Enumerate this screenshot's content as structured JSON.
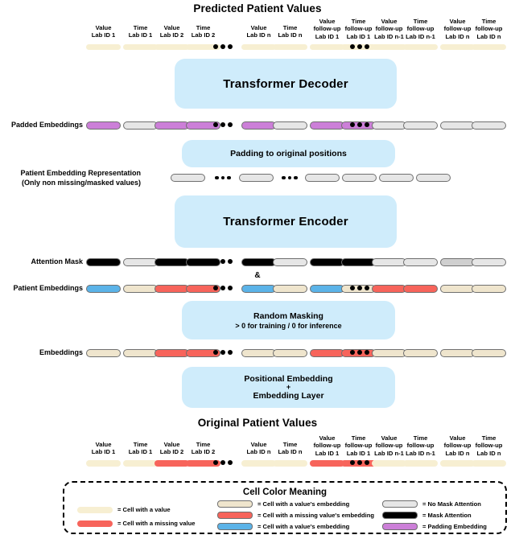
{
  "diagram": {
    "top_title": "Predicted Patient Values",
    "bottom_title": "Original Patient Values",
    "amp": "&"
  },
  "colors": {
    "value_cream": "#f7efd2",
    "missing_red": "#f7645b",
    "embed_cream": "#efe5cd",
    "embed_blue": "#5bb3e8",
    "no_mask_gray": "#cfcfcf",
    "mask_black": "#000000",
    "padding_purple": "#cc7fd8",
    "box_blue": "#cfecfb",
    "outline": "#6f6f6f"
  },
  "columns": [
    {
      "l1": "Value",
      "l2": "Lab ID 1",
      "l3": ""
    },
    {
      "l1": "Time",
      "l2": "Lab ID 1",
      "l3": ""
    },
    {
      "l1": "Value",
      "l2": "Lab ID 2",
      "l3": ""
    },
    {
      "l1": "Time",
      "l2": "Lab ID 2",
      "l3": ""
    },
    {
      "l1": "Value",
      "l2": "Lab ID n",
      "l3": ""
    },
    {
      "l1": "Time",
      "l2": "Lab ID n",
      "l3": ""
    },
    {
      "l1": "Value",
      "l2": "follow-up",
      "l3": "Lab ID 1"
    },
    {
      "l1": "Time",
      "l2": "follow-up",
      "l3": "Lab ID 1"
    },
    {
      "l1": "Value",
      "l2": "follow-up",
      "l3": "Lab ID n-1"
    },
    {
      "l1": "Time",
      "l2": "follow-up",
      "l3": "Lab ID n-1"
    },
    {
      "l1": "Value",
      "l2": "follow-up",
      "l3": "Lab ID n"
    },
    {
      "l1": "Time",
      "l2": "follow-up",
      "l3": "Lab ID n"
    }
  ],
  "boxes": {
    "decoder": "Transformer Decoder",
    "padding": "Padding to original positions",
    "encoder": "Transformer Encoder",
    "masking_title": "Random Masking",
    "masking_sub": "> 0 for training / 0 for inference",
    "positional_l1": "Positional Embedding",
    "positional_l2": "+",
    "positional_l3": "Embedding Layer"
  },
  "rows": {
    "predicted_values": {
      "label": "",
      "cells": [
        "value",
        "value",
        "value",
        "value",
        "value",
        "value",
        "value",
        "value",
        "value",
        "value",
        "value",
        "value"
      ]
    },
    "padded_embeddings": {
      "label": "Padded Embeddings",
      "cells": [
        "padding",
        "nomask",
        "padding",
        "padding",
        "padding",
        "nomask",
        "padding",
        "padding",
        "nomask",
        "nomask",
        "nomask",
        "nomask"
      ]
    },
    "patient_embedding_representation": {
      "label": "Patient Embedding Representation\n(Only non missing/masked values)",
      "cells": [
        "nomask",
        "nomask",
        "nomask",
        "nomask",
        "nomask",
        "nomask"
      ]
    },
    "attention_mask": {
      "label": "Attention Mask",
      "cells": [
        "mask",
        "nomask",
        "mask",
        "mask",
        "mask",
        "nomask",
        "mask",
        "mask",
        "nomask",
        "nomask",
        "nomask2",
        "nomask"
      ]
    },
    "patient_embeddings": {
      "label": "Patient Embeddings",
      "cells": [
        "embedblue",
        "embedcream",
        "embedred",
        "embedred",
        "embedblue",
        "embedcream",
        "embedblue",
        "embedcream",
        "embedred",
        "embedred",
        "embedcream",
        "embedcream"
      ]
    },
    "embeddings": {
      "label": "Embeddings",
      "cells": [
        "embedcream",
        "embedcream",
        "embedred",
        "embedred",
        "embedcream",
        "embedcream",
        "embedred",
        "embedred",
        "embedcream",
        "embedcream",
        "embedcream",
        "embedcream"
      ]
    },
    "original_values": {
      "label": "",
      "cells": [
        "value",
        "value",
        "missing",
        "missing",
        "value",
        "value",
        "missing",
        "missing",
        "value",
        "value",
        "value",
        "value"
      ]
    }
  },
  "legend": {
    "title": "Cell Color Meaning",
    "col1": [
      {
        "swatch": "value",
        "text": "= Cell with a value"
      },
      {
        "swatch": "missing",
        "text": "= Cell with a missing value"
      }
    ],
    "col2": [
      {
        "swatch": "embedcream",
        "text": "= Cell with a value's embedding"
      },
      {
        "swatch": "embedred",
        "text": "= Cell with a missing value's embedding"
      },
      {
        "swatch": "embedblue",
        "text": "= Cell with a value's embedding"
      }
    ],
    "col3": [
      {
        "swatch": "nomask",
        "text": "= No Mask Attention"
      },
      {
        "swatch": "mask",
        "text": "= Mask Attention"
      },
      {
        "swatch": "padding",
        "text": "= Padding Embedding"
      }
    ]
  }
}
